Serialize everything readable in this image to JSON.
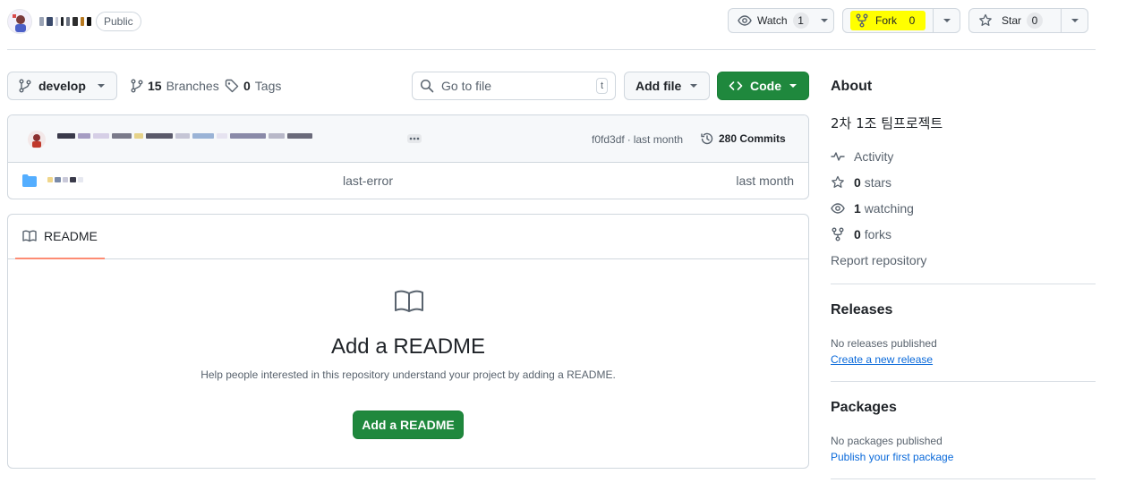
{
  "header": {
    "visibility": "Public",
    "watch": {
      "label": "Watch",
      "count": "1"
    },
    "fork": {
      "label": "Fork",
      "count": "0"
    },
    "star": {
      "label": "Star",
      "count": "0"
    }
  },
  "toolbar": {
    "branch": "develop",
    "branches_count": "15",
    "branches_label": "Branches",
    "tags_count": "0",
    "tags_label": "Tags",
    "search_placeholder": "Go to file",
    "search_shortcut": "t",
    "add_file_label": "Add file",
    "code_label": "Code"
  },
  "commit": {
    "hash": "f0fd3df",
    "separator": "·",
    "time": "last month",
    "count_label": "280 Commits"
  },
  "files": [
    {
      "commit_message": "last-error",
      "time": "last month"
    }
  ],
  "readme": {
    "tab_label": "README",
    "title": "Add a README",
    "description": "Help people interested in this repository understand your project by adding a README.",
    "button_label": "Add a README"
  },
  "sidebar": {
    "about_title": "About",
    "description": "2차 1조 팀프로젝트",
    "activity_label": "Activity",
    "stars_count": "0",
    "stars_label": "stars",
    "watching_count": "1",
    "watching_label": "watching",
    "forks_count": "0",
    "forks_label": "forks",
    "report_label": "Report repository",
    "releases_title": "Releases",
    "releases_empty": "No releases published",
    "releases_link": "Create a new release",
    "packages_title": "Packages",
    "packages_empty": "No packages published",
    "packages_link": "Publish your first package"
  },
  "colors": {
    "accent_green": "#1f883d",
    "link_blue": "#0969da",
    "fork_highlight": "#ffff00",
    "tab_underline": "#fd8c73",
    "folder_blue": "#54aeff"
  },
  "icons": [
    "avatar",
    "eye-icon",
    "repo-forked-icon",
    "star-icon",
    "triangle-down-icon",
    "git-branch-icon",
    "tag-icon",
    "search-icon",
    "code-icon",
    "history-icon",
    "kebab-horizontal-icon",
    "folder-icon",
    "book-icon",
    "pulse-icon"
  ]
}
